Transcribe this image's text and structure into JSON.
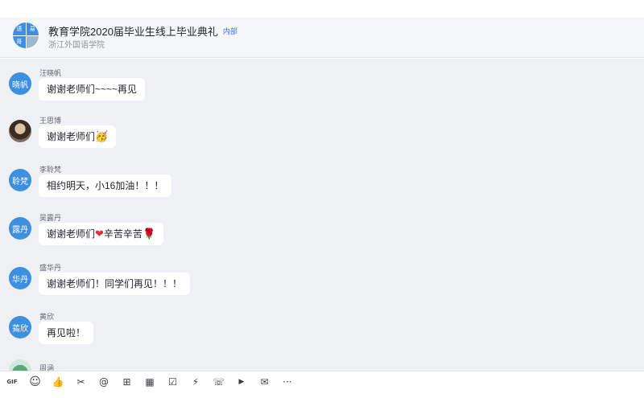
{
  "header": {
    "title": "教育学院2020届毕业生线上毕业典礼",
    "tag": "内部",
    "subtitle": "浙江外国语学院",
    "group_avatar_cells": [
      "语",
      "易",
      "哥",
      ""
    ]
  },
  "messages": [
    {
      "avatar_text": "晓帆",
      "sender": "汪晓帆",
      "text": "谢谢老师们~~~~再见",
      "emoji": ""
    },
    {
      "avatar_text": "",
      "sender": "王思博",
      "text": "谢谢老师们",
      "emoji": "🥳"
    },
    {
      "avatar_text": "聆梵",
      "sender": "李聆梵",
      "text": "相约明天，小16加油！！！",
      "emoji": ""
    },
    {
      "avatar_text": "露丹",
      "sender": "吴露丹",
      "text": "谢谢老师们",
      "emoji": "❤",
      "text2": "辛苦辛苦",
      "emoji2": "🌹"
    },
    {
      "avatar_text": "华丹",
      "sender": "盛华丹",
      "text": "谢谢老师们！同学们再见！！！",
      "emoji": ""
    },
    {
      "avatar_text": "蔫欣",
      "sender": "黄欣",
      "text": "再见啦！",
      "emoji": ""
    },
    {
      "avatar_text": "",
      "sender": "周涵",
      "text": "",
      "emoji": ""
    }
  ],
  "toolbar": {
    "icons": [
      {
        "name": "gif-icon",
        "glyph": "GIF"
      },
      {
        "name": "emoji-icon",
        "glyph": "☺"
      },
      {
        "name": "thumbs-up-icon",
        "glyph": "👍"
      },
      {
        "name": "scissors-icon",
        "glyph": "✂"
      },
      {
        "name": "at-mention-icon",
        "glyph": "@"
      },
      {
        "name": "add-file-icon",
        "glyph": "⊞"
      },
      {
        "name": "calendar-icon",
        "glyph": "▦"
      },
      {
        "name": "checkbox-icon",
        "glyph": "☑"
      },
      {
        "name": "lightning-icon",
        "glyph": "⚡"
      },
      {
        "name": "phone-icon",
        "glyph": "☏"
      },
      {
        "name": "video-icon",
        "glyph": "▶"
      },
      {
        "name": "mail-icon",
        "glyph": "✉"
      },
      {
        "name": "more-icon",
        "glyph": "···"
      }
    ]
  },
  "colors": {
    "accent": "#3370ff",
    "avatar_blue": "#3d8fe0",
    "chat_bg": "#eef0f3"
  }
}
